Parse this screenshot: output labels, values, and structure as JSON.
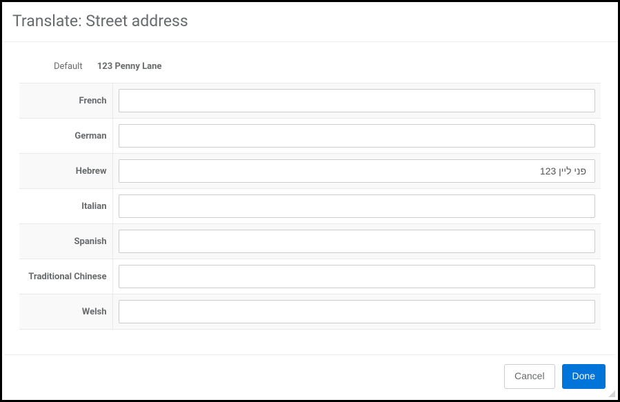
{
  "header": {
    "title": "Translate: Street address"
  },
  "default": {
    "label": "Default",
    "value": "123 Penny Lane"
  },
  "languages": [
    {
      "key": "french",
      "label": "French",
      "value": "",
      "rtl": false
    },
    {
      "key": "german",
      "label": "German",
      "value": "",
      "rtl": false
    },
    {
      "key": "hebrew",
      "label": "Hebrew",
      "value": "פני ליין 123",
      "rtl": true
    },
    {
      "key": "italian",
      "label": "Italian",
      "value": "",
      "rtl": false
    },
    {
      "key": "spanish",
      "label": "Spanish",
      "value": "",
      "rtl": false
    },
    {
      "key": "zh-tw",
      "label": "Traditional Chinese",
      "value": "",
      "rtl": false
    },
    {
      "key": "welsh",
      "label": "Welsh",
      "value": "",
      "rtl": false
    }
  ],
  "footer": {
    "cancel_label": "Cancel",
    "done_label": "Done"
  }
}
